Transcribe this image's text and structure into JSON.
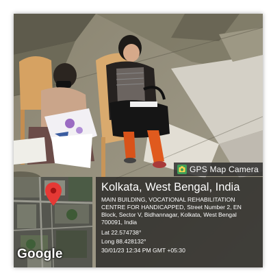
{
  "watermark": {
    "app_name": "GPS Map Camera",
    "map_brand": "Google",
    "location_title": "Kolkata, West Bengal, India",
    "address": "MAIN BUILDING, VOCATIONAL REHABILITATION CENTRE FOR HANDICAPPED, Street Number 2, EN Block, Sector V, Bidhannagar, Kolkata, West Bengal 700091, India",
    "latitude": "Lat 22.574738°",
    "longitude": "Long 88.428132°",
    "datetime": "30/01/23 12:34 PM GMT +05:30"
  },
  "colors": {
    "pin": "#e53935",
    "panel": "#191919",
    "text": "#ffffff"
  },
  "icons": [
    "camera-icon",
    "map-pin-icon"
  ]
}
